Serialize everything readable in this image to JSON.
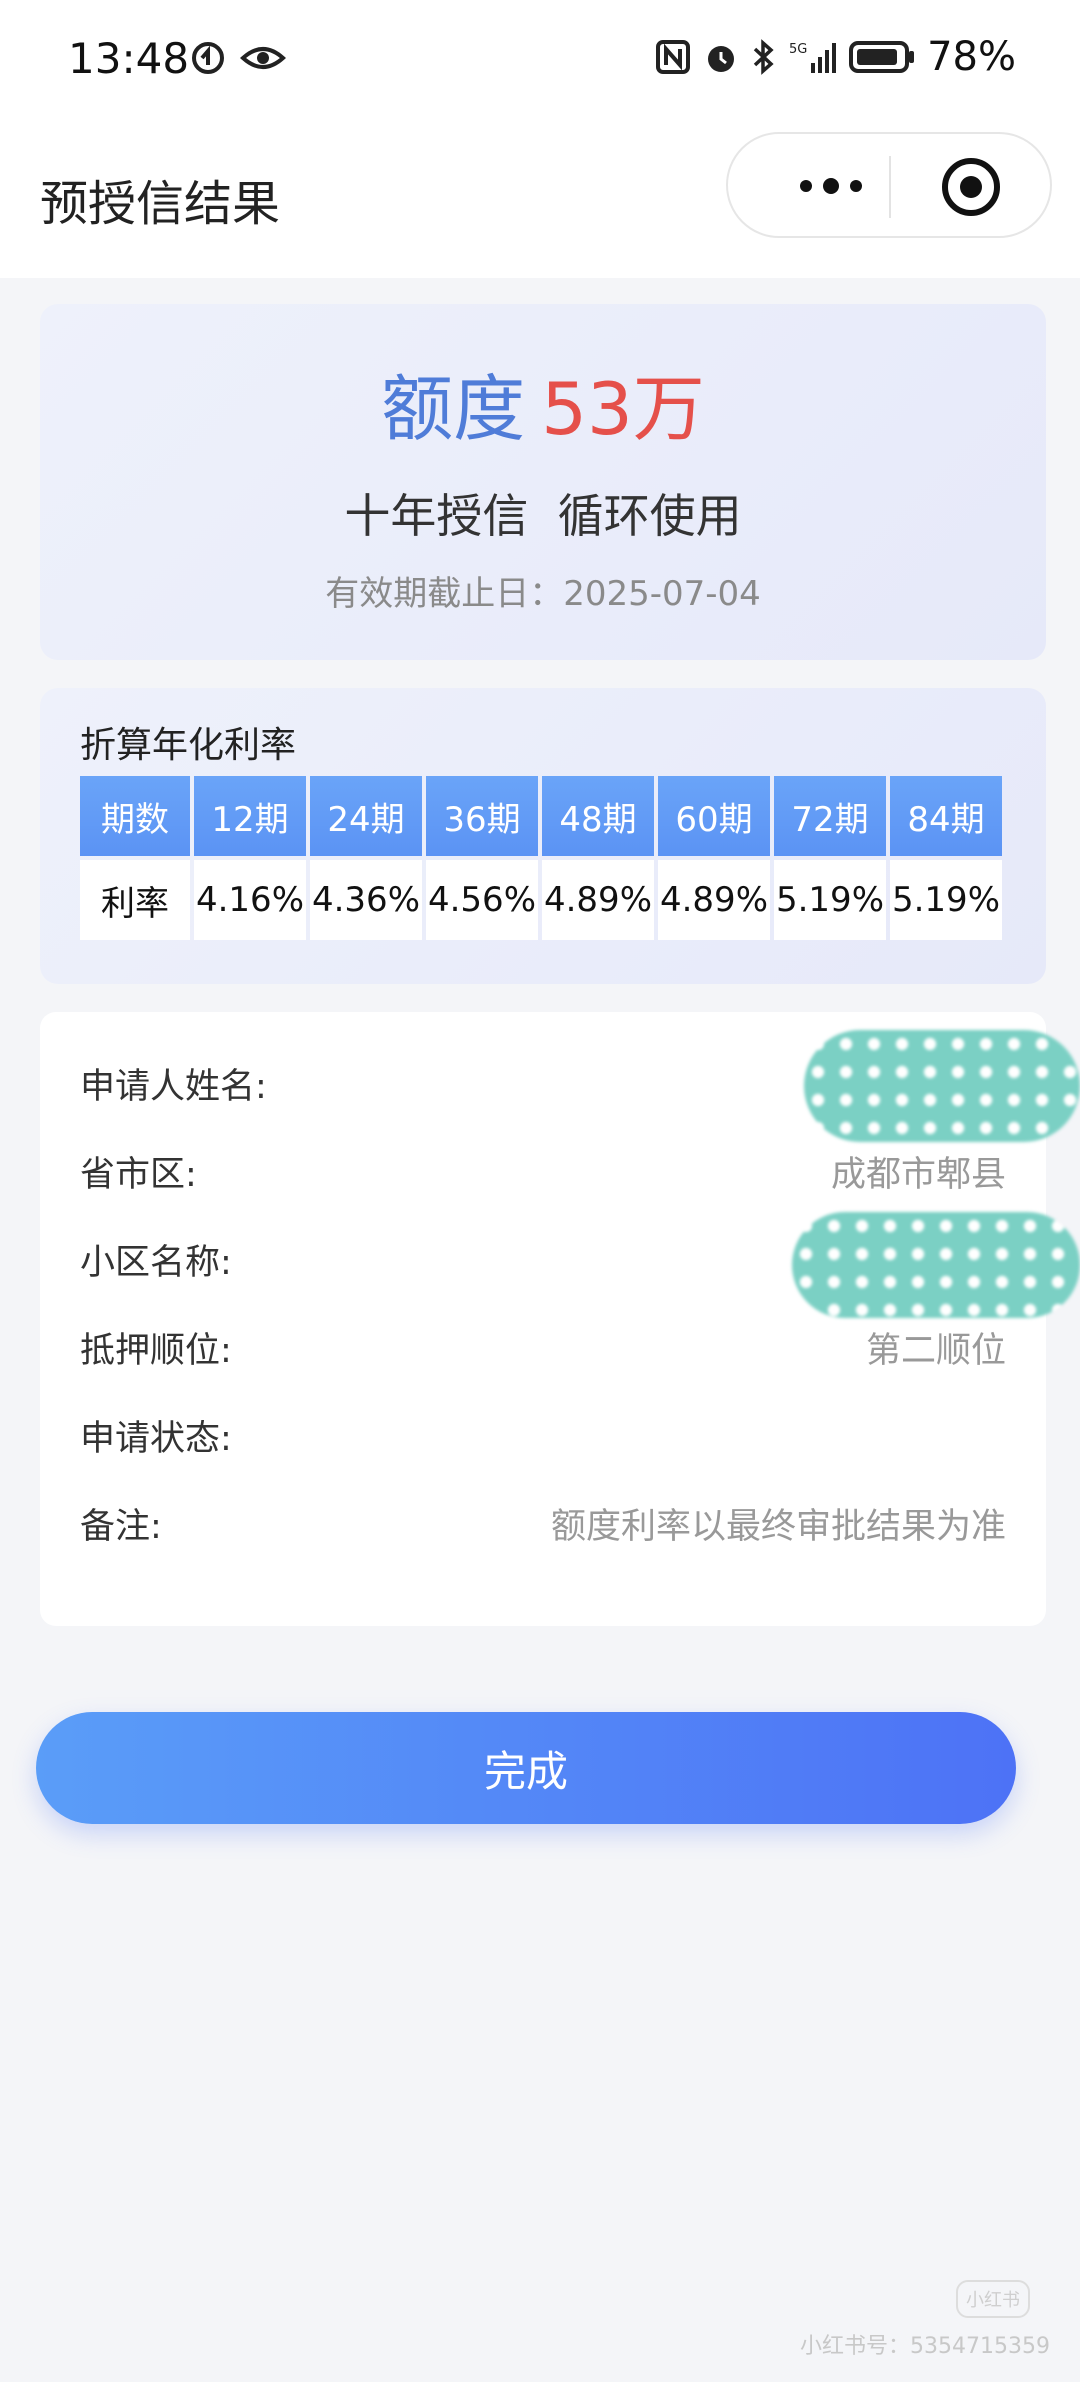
{
  "status_bar": {
    "time": "13:48",
    "battery": "78%",
    "network": "5G"
  },
  "nav": {
    "title": "预授信结果",
    "more_icon": "more-dots-icon",
    "close_icon": "target-circle-icon"
  },
  "credit": {
    "amount_label": "额度",
    "amount_value": "53万",
    "subtitle": "十年授信  循环使用",
    "expiry_label": "有效期截止日：",
    "expiry_date": "2025-07-04"
  },
  "rates": {
    "title": "折算年化利率",
    "header_period": "期数",
    "header_rate": "利率",
    "columns": [
      {
        "period": "12期",
        "rate": "4.16%"
      },
      {
        "period": "24期",
        "rate": "4.36%"
      },
      {
        "period": "36期",
        "rate": "4.56%"
      },
      {
        "period": "48期",
        "rate": "4.89%"
      },
      {
        "period": "60期",
        "rate": "4.89%"
      },
      {
        "period": "72期",
        "rate": "5.19%"
      },
      {
        "period": "84期",
        "rate": "5.19%"
      }
    ]
  },
  "info": {
    "applicant_label": "申请人姓名:",
    "applicant_value": "",
    "region_label": "省市区:",
    "region_value": "成都市郫县",
    "community_label": "小区名称:",
    "community_value": "",
    "mortgage_label": "抵押顺位:",
    "mortgage_value": "第二顺位",
    "status_label": "申请状态:",
    "status_value": "",
    "remark_label": "备注:",
    "remark_value": "额度利率以最终审批结果为准"
  },
  "actions": {
    "done_label": "完成"
  },
  "watermark": {
    "logo_text": "小红书",
    "id_text": "小红书号：5354715359"
  }
}
